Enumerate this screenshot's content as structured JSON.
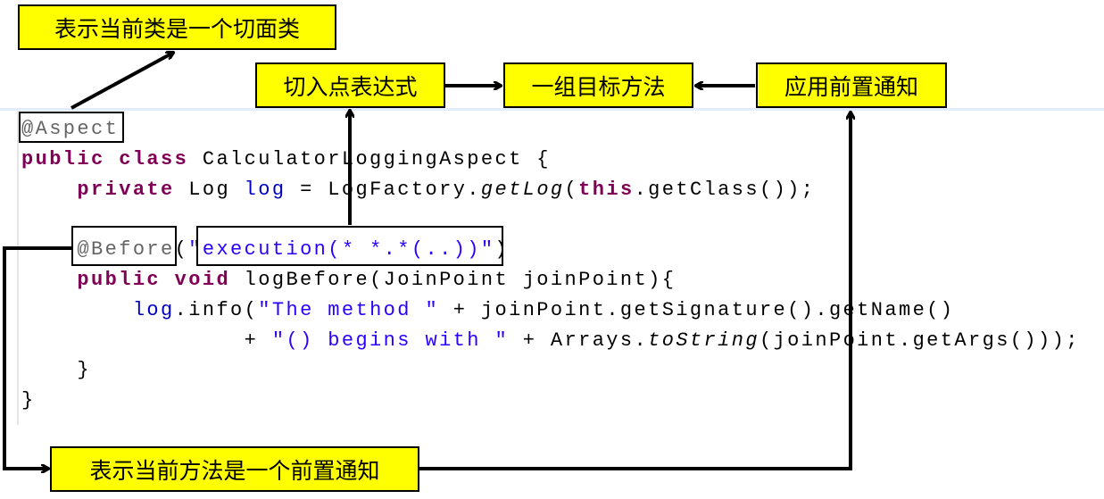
{
  "labels": {
    "aspect_class": "表示当前类是一个切面类",
    "pointcut_expression": "切入点表达式",
    "target_methods": "一组目标方法",
    "apply_before_advice": "应用前置通知",
    "before_advice_method": "表示当前方法是一个前置通知"
  },
  "code": {
    "l1_ann": "@Aspect",
    "l2_kw": "public class",
    "l2_rest": " CalculatorLoggingAspect {",
    "l3_indent": "    ",
    "l3_kw": "private",
    "l3_a": " Log ",
    "l3_fld": "log",
    "l3_b": " = LogFactory.",
    "l3_it": "getLog",
    "l3_c": "(",
    "l3_kw2": "this",
    "l3_d": ".getClass());",
    "l5_indent": "    ",
    "l5_ann": "@Before",
    "l5_a": "(",
    "l5_str": "\"execution(* *.*(..))\"",
    "l5_b": ")",
    "l6_indent": "    ",
    "l6_kw": "public void",
    "l6_rest": " logBefore(JoinPoint joinPoint){",
    "l7_indent": "        ",
    "l7_fld": "log",
    "l7_a": ".info(",
    "l7_str": "\"The method \"",
    "l7_b": " + joinPoint.getSignature().getName()",
    "l8_indent": "                + ",
    "l8_str": "\"() begins with \"",
    "l8_a": " + Arrays.",
    "l8_it": "toString",
    "l8_b": "(joinPoint.getArgs()));",
    "l9": "    }",
    "l10": "}"
  },
  "colors": {
    "label_fill": "#ffff00",
    "keyword": "#7f0055",
    "annotation": "#646464",
    "field": "#0000c0",
    "string": "#2a00ff"
  }
}
